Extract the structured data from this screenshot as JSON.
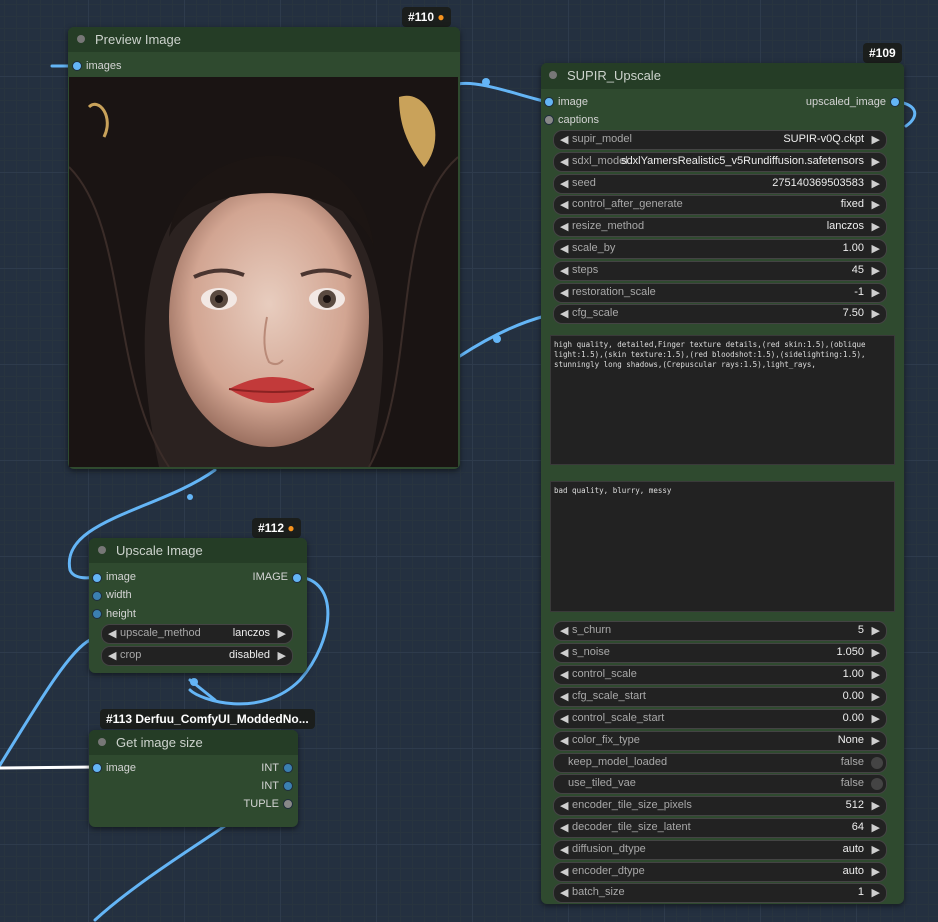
{
  "colors": {
    "canvas": "#243040",
    "node_body": "#2f4a2f",
    "node_header": "#253d26",
    "wire": "#64b5f6"
  },
  "preview_node": {
    "badge": "#110",
    "badge_icon": "fox-icon",
    "title": "Preview Image",
    "input_label": "images",
    "image_alt": "portrait-photo"
  },
  "supir_node": {
    "badge": "#109",
    "title": "SUPIR_Upscale",
    "inputs": [
      "image",
      "captions"
    ],
    "output": "upscaled_image",
    "widgets_top": [
      {
        "name": "supir_model",
        "value": "SUPIR-v0Q.ckpt"
      },
      {
        "name": "sdxl_model",
        "value": "sdxlYamersRealistic5_v5Rundiffusion.safetensors"
      },
      {
        "name": "seed",
        "value": "275140369503583"
      },
      {
        "name": "control_after_generate",
        "value": "fixed"
      },
      {
        "name": "resize_method",
        "value": "lanczos"
      },
      {
        "name": "scale_by",
        "value": "1.00"
      },
      {
        "name": "steps",
        "value": "45"
      },
      {
        "name": "restoration_scale",
        "value": "-1"
      },
      {
        "name": "cfg_scale",
        "value": "7.50"
      }
    ],
    "positive_prompt": "high quality, detailed,Finger texture details,(red skin:1.5),(oblique light:1.5),(skin texture:1.5),(red bloodshot:1.5),(sidelighting:1.5), stunningly long shadows,(Crepuscular rays:1.5),light_rays,",
    "negative_prompt": "bad quality, blurry, messy",
    "widgets_bottom": [
      {
        "name": "s_churn",
        "value": "5"
      },
      {
        "name": "s_noise",
        "value": "1.050"
      },
      {
        "name": "control_scale",
        "value": "1.00"
      },
      {
        "name": "cfg_scale_start",
        "value": "0.00"
      },
      {
        "name": "control_scale_start",
        "value": "0.00"
      },
      {
        "name": "color_fix_type",
        "value": "None"
      }
    ],
    "toggles": [
      {
        "name": "keep_model_loaded",
        "value": "false"
      },
      {
        "name": "use_tiled_vae",
        "value": "false"
      }
    ],
    "widgets_end": [
      {
        "name": "encoder_tile_size_pixels",
        "value": "512"
      },
      {
        "name": "decoder_tile_size_latent",
        "value": "64"
      },
      {
        "name": "diffusion_dtype",
        "value": "auto"
      },
      {
        "name": "encoder_dtype",
        "value": "auto"
      },
      {
        "name": "batch_size",
        "value": "1"
      }
    ]
  },
  "upscale_node": {
    "badge": "#112",
    "badge_icon": "fox-icon",
    "title": "Upscale Image",
    "inputs": [
      "image",
      "width",
      "height"
    ],
    "output": "IMAGE",
    "widgets": [
      {
        "name": "upscale_method",
        "value": "lanczos"
      },
      {
        "name": "crop",
        "value": "disabled"
      }
    ]
  },
  "size_node": {
    "badge": "#113 Derfuu_ComfyUI_ModdedNo...",
    "title": "Get image size",
    "input": "image",
    "outputs": [
      "INT",
      "INT",
      "TUPLE"
    ]
  },
  "glyphs": {
    "left": "◀",
    "right": "▶"
  }
}
